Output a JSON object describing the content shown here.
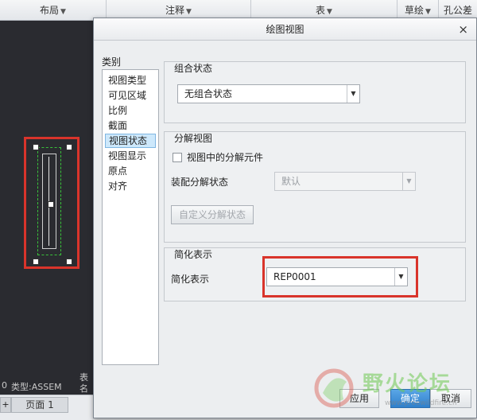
{
  "ribbon": {
    "items": [
      {
        "label": "布局",
        "caret": "▼"
      },
      {
        "label": "注释",
        "caret": "▼"
      },
      {
        "label": "表",
        "caret": "▼"
      },
      {
        "label": "草绘",
        "caret": "▼"
      },
      {
        "label": "孔公差",
        "caret": ""
      }
    ]
  },
  "canvas": {
    "type_label": "类型:ASSEM",
    "table_fragment": "表",
    "name_fragment": "名",
    "left_fragment": "0"
  },
  "bottom": {
    "add_label": "+",
    "page_tab": "页面 1"
  },
  "dialog": {
    "title": "绘图视图",
    "close": "×",
    "category_label": "类别",
    "categories": [
      "视图类型",
      "可见区域",
      "比例",
      "截面",
      "视图状态",
      "视图显示",
      "原点",
      "对齐"
    ],
    "selected_category": "视图状态",
    "combo_state": {
      "title": "组合状态",
      "value": "无组合状态"
    },
    "explode": {
      "title": "分解视图",
      "checkbox_label": "视图中的分解元件",
      "checked": false,
      "assembly_label": "装配分解状态",
      "assembly_value": "默认",
      "custom_button": "自定义分解状态"
    },
    "simplified": {
      "title": "简化表示",
      "label": "简化表示",
      "value": "REP0001"
    },
    "buttons": {
      "apply": "应用",
      "ok": "确定",
      "cancel": "取消"
    }
  },
  "watermark": {
    "text": "野火论坛",
    "url": "www.proewildfire.cn"
  },
  "colors": {
    "highlight_red": "#d9342b",
    "selection_blue": "#cde8fb",
    "primary_button": "#2f7fcb"
  },
  "icons": [
    "caret-down-icon",
    "close-icon",
    "dropdown-arrow-icon",
    "plus-icon",
    "logo-icon"
  ]
}
